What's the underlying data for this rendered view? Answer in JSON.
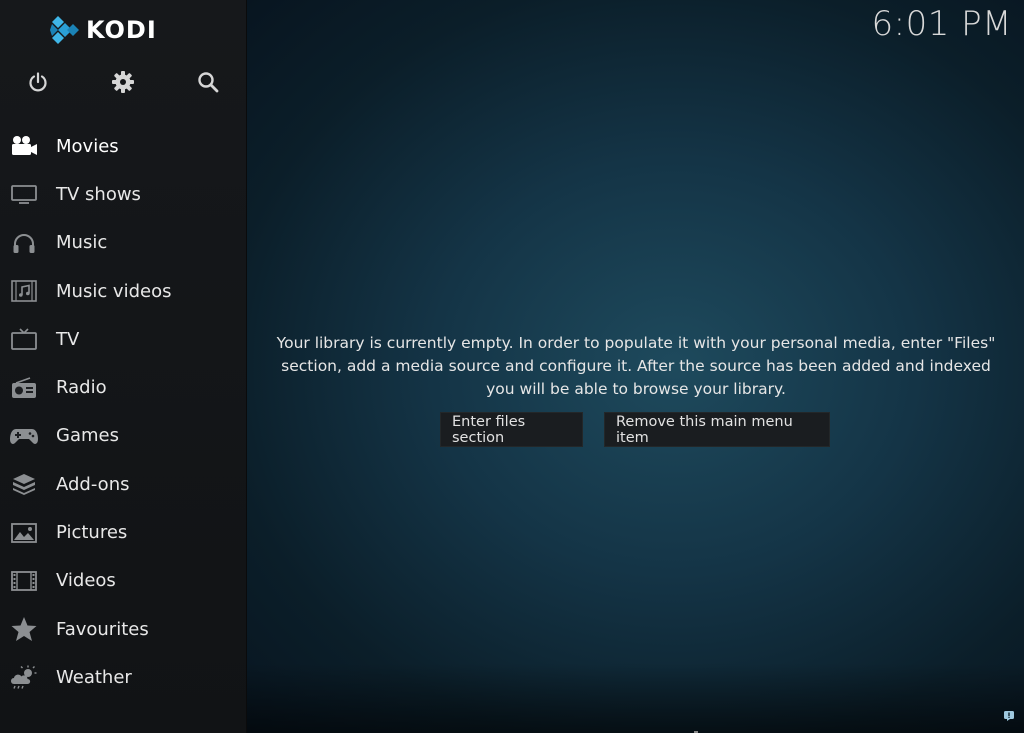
{
  "app": {
    "logo_text": "KODI",
    "clock": "6:01 PM"
  },
  "colors": {
    "logo_blue_light": "#3fb6e8",
    "logo_blue_dark": "#1b83b7",
    "sidebar_bg": "#141618",
    "main_bg": "#143446",
    "button_bg": "#1a1d20"
  },
  "top_icons": [
    {
      "name": "power-icon"
    },
    {
      "name": "gear-icon"
    },
    {
      "name": "search-icon"
    }
  ],
  "menu": {
    "items": [
      {
        "label": "Movies",
        "icon": "movie-camera-icon"
      },
      {
        "label": "TV shows",
        "icon": "monitor-icon"
      },
      {
        "label": "Music",
        "icon": "headphones-icon"
      },
      {
        "label": "Music videos",
        "icon": "music-video-icon"
      },
      {
        "label": "TV",
        "icon": "tv-icon"
      },
      {
        "label": "Radio",
        "icon": "radio-icon"
      },
      {
        "label": "Games",
        "icon": "gamepad-icon"
      },
      {
        "label": "Add-ons",
        "icon": "box-icon"
      },
      {
        "label": "Pictures",
        "icon": "picture-icon"
      },
      {
        "label": "Videos",
        "icon": "film-strip-icon"
      },
      {
        "label": "Favourites",
        "icon": "star-icon"
      },
      {
        "label": "Weather",
        "icon": "weather-icon"
      }
    ]
  },
  "main": {
    "message": "Your library is currently empty. In order to populate it with your personal media, enter \"Files\" section, add a media source and configure it. After the source has been added and indexed you will be able to browse your library.",
    "enter_files_label": "Enter files section",
    "remove_item_label": "Remove this main menu item"
  }
}
